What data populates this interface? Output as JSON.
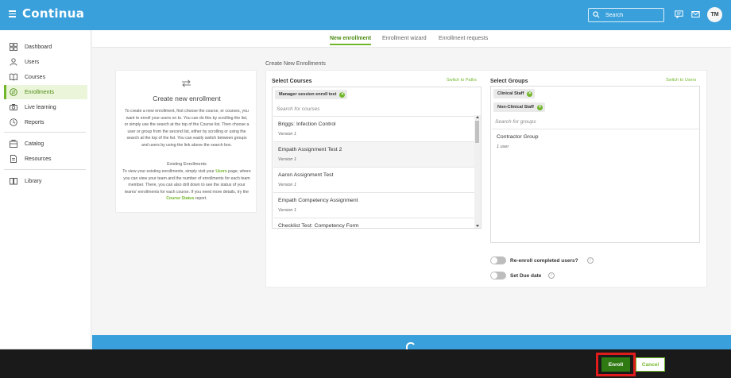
{
  "header": {
    "logo": "Continua",
    "search_placeholder": "Search",
    "avatar_initials": "TM"
  },
  "sidebar": {
    "items": [
      {
        "label": "Dashboard",
        "icon": "dashboard-icon"
      },
      {
        "label": "Users",
        "icon": "user-icon"
      },
      {
        "label": "Courses",
        "icon": "book-icon"
      },
      {
        "label": "Enrollments",
        "icon": "enrollment-icon",
        "active": true
      },
      {
        "label": "Live learning",
        "icon": "camera-icon"
      },
      {
        "label": "Reports",
        "icon": "clock-icon"
      },
      {
        "label": "Catalog",
        "icon": "catalog-icon"
      },
      {
        "label": "Resources",
        "icon": "document-icon"
      },
      {
        "label": "Library",
        "icon": "library-icon"
      }
    ]
  },
  "tabs": [
    {
      "label": "New enrollment",
      "active": true
    },
    {
      "label": "Enrollment wizard"
    },
    {
      "label": "Enrollment requests"
    }
  ],
  "main": {
    "section_title": "Create New Enrollments",
    "info_card": {
      "title": "Create new enrollment",
      "paragraph1": "To create a new enrollment, first choose the course, or courses, you want to enroll your users on to. You can do this by scrolling the list, or simply use the search at the top of the Course list. Then choose a user or group from the second list, either by scrolling or using the search at the top of the list. You can easily switch between groups and users by using the link above the search box.",
      "subtitle2": "Existing Enrollments",
      "p2_a": "To view your existing enrollments, simply visit your ",
      "p2_link1": "Users",
      "p2_b": " page, where you can view your team and the number of enrollments for each team member. There, you can also drill down to see the status of your teams' enrollments for each course. If you need more details, try the ",
      "p2_link2": "Course Status",
      "p2_c": " report."
    },
    "courses": {
      "label": "Select Courses",
      "switch_link": "Switch to Paths",
      "selected_chip": "Manager session enroll test",
      "search_placeholder": "Search for courses",
      "items": [
        {
          "name": "Briggs: Infection Control",
          "version": "Version 1"
        },
        {
          "name": "Empath Assignment Test 2",
          "version": "Version 1"
        },
        {
          "name": "Aaron Assignment Test",
          "version": "Version 1"
        },
        {
          "name": "Empath Competency Assignment",
          "version": "Version 1"
        },
        {
          "name": "Checklist Test: Competency Form",
          "version": ""
        }
      ]
    },
    "groups": {
      "label": "Select Groups",
      "switch_link": "Switch to Users",
      "selected_chips": [
        "Clinical Staff",
        "Non-Clinical Staff"
      ],
      "search_placeholder": "Search for groups",
      "items": [
        {
          "name": "Contractor Group",
          "count": "1 user"
        }
      ]
    },
    "options": {
      "reenroll_label": "Re-enroll completed users?",
      "due_date_label": "Set Due date"
    }
  },
  "actions": {
    "enroll_label": "Enroll",
    "cancel_label": "Cancel"
  },
  "colors": {
    "brand_blue": "#3aa0dc",
    "accent_green": "#71b62a",
    "enroll_green": "#2f7a12",
    "highlight_red": "#e01b1b"
  }
}
